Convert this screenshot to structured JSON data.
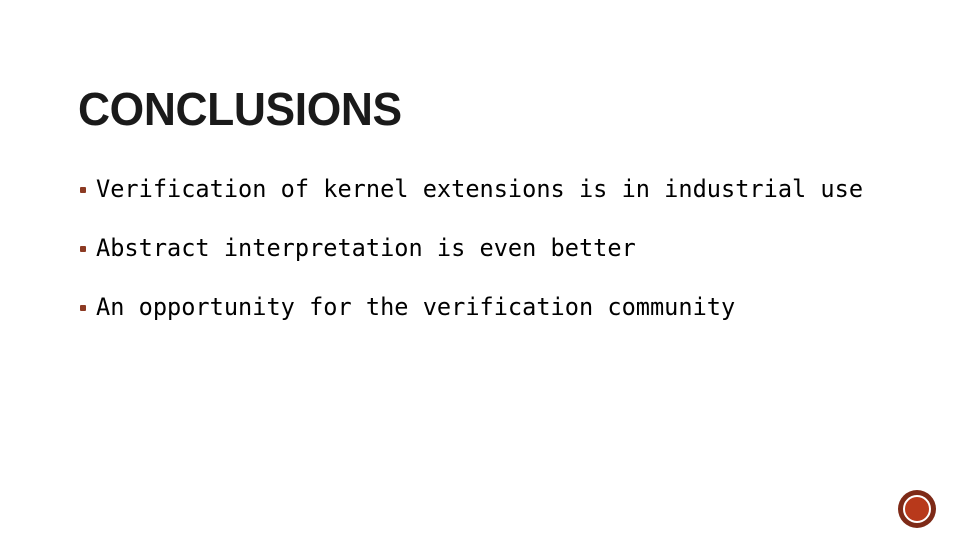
{
  "slide": {
    "title": "CONCLUSIONS",
    "background_color": "#ffffff",
    "title_color": "#1a1a1a",
    "bullet_marker_color": "#8c3a23",
    "body_text_color": "#000000",
    "bullets": [
      {
        "text": "Verification of kernel extensions is in industrial use"
      },
      {
        "text": "Abstract interpretation is even better"
      },
      {
        "text": "An opportunity for the verification community"
      }
    ],
    "logo": {
      "name": "circular-logo",
      "ring_color": "#7e2a17",
      "fill_color": "#b8391b"
    }
  }
}
